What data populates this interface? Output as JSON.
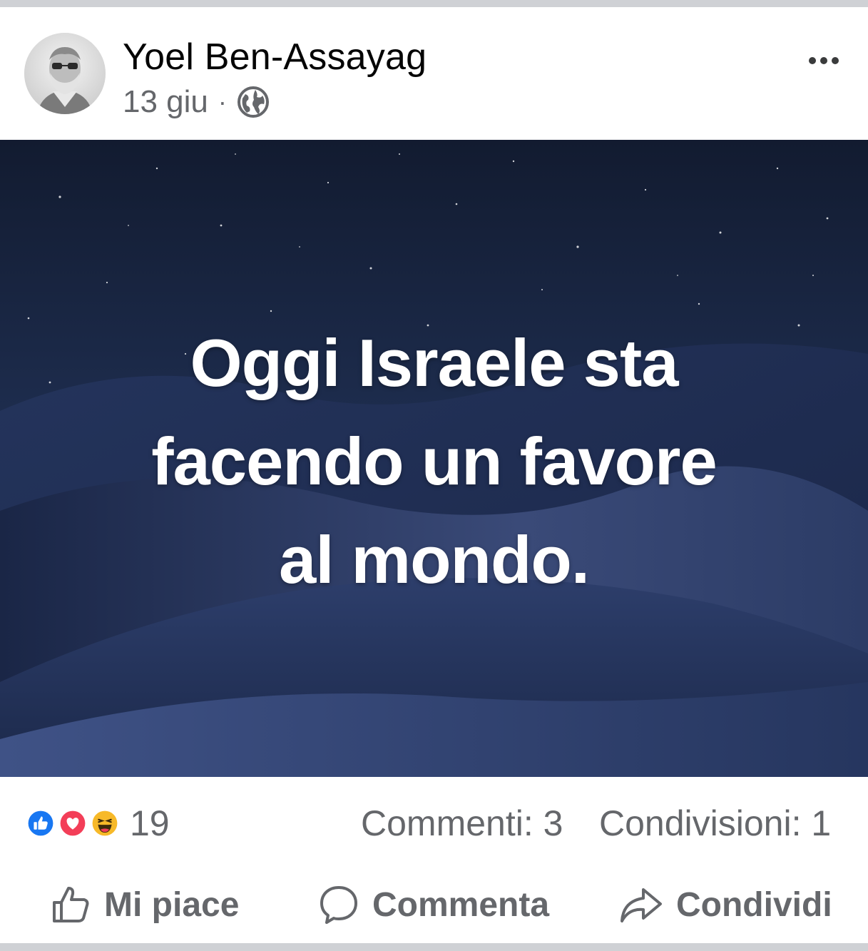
{
  "post": {
    "author": "Yoel Ben-Assayag",
    "date": "13 giu",
    "separator": "·",
    "privacy_icon": "globe-icon",
    "more_icon": "more-options-icon",
    "image_text_lines": [
      "Oggi Israele sta",
      "facendo un favore",
      "al mondo."
    ]
  },
  "reactions": {
    "icons": [
      "like-reaction-icon",
      "love-reaction-icon",
      "haha-reaction-icon"
    ],
    "count": "19",
    "comments": "Commenti: 3",
    "shares": "Condivisioni: 1"
  },
  "actions": {
    "like": "Mi piace",
    "comment": "Commenta",
    "share": "Condividi"
  },
  "colors": {
    "like_blue": "#1877f2",
    "love_red": "#f33e58",
    "haha_yellow": "#f7b928",
    "secondary_text": "#65676b",
    "night_sky": "#1b2a4a"
  }
}
